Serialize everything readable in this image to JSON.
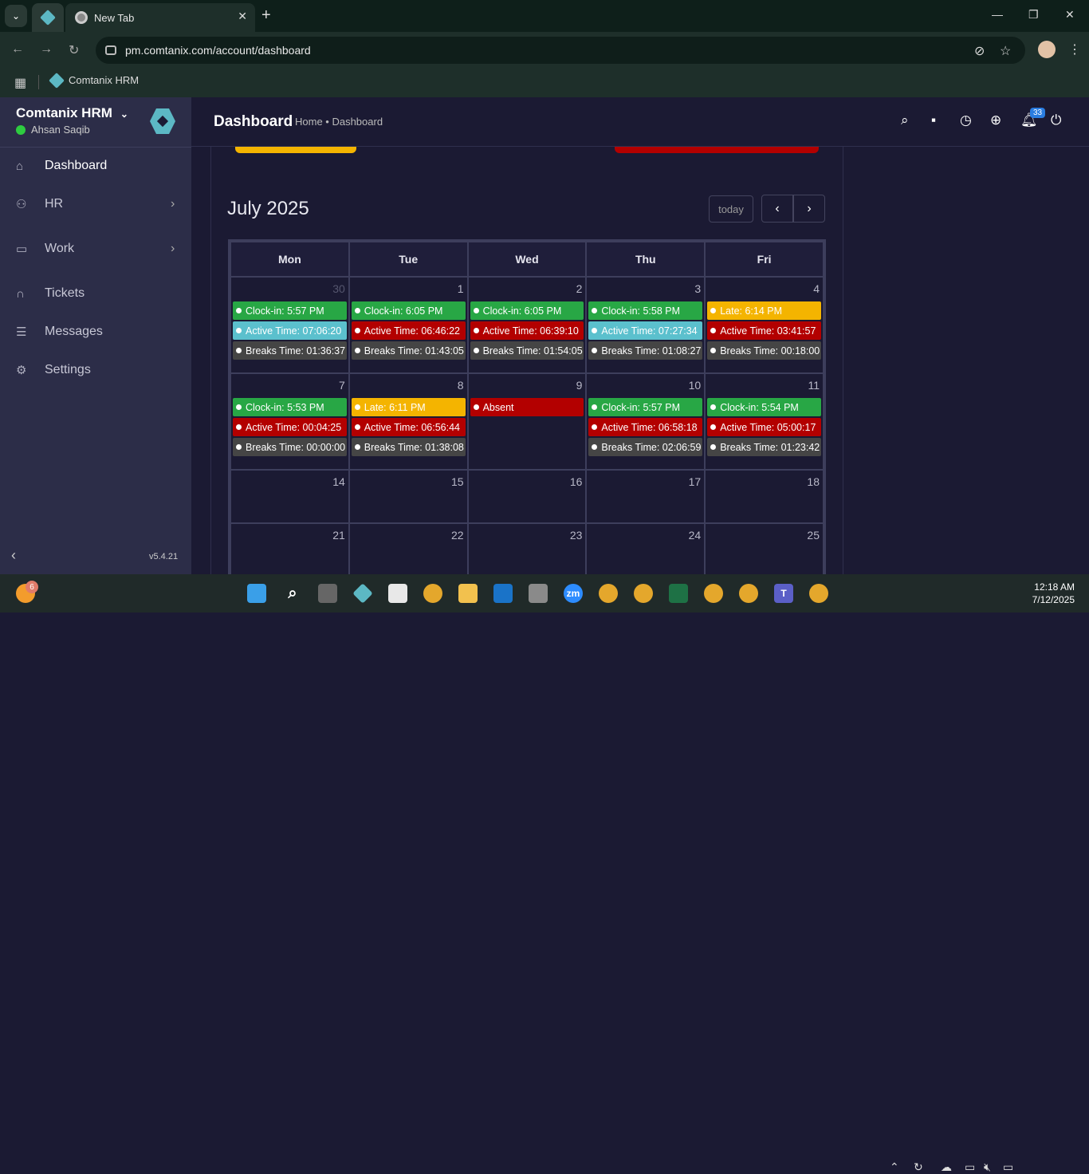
{
  "browser": {
    "tab_title": "New Tab",
    "url": "pm.comtanix.com/account/dashboard",
    "bookmark": "Comtanix HRM"
  },
  "sidebar": {
    "brand": "Comtanix HRM",
    "user": "Ahsan Saqib",
    "items": [
      {
        "label": "Dashboard",
        "icon": "home-icon"
      },
      {
        "label": "HR",
        "icon": "users-icon"
      },
      {
        "label": "Work",
        "icon": "briefcase-icon"
      },
      {
        "label": "Tickets",
        "icon": "headset-icon"
      },
      {
        "label": "Messages",
        "icon": "message-icon"
      },
      {
        "label": "Settings",
        "icon": "gear-icon"
      }
    ],
    "version": "v5.4.21"
  },
  "header": {
    "title": "Dashboard",
    "breadcrumb": "Home • Dashboard",
    "notifications": "33"
  },
  "calendar": {
    "title": "July 2025",
    "today_label": "today",
    "weekdays": [
      "Mon",
      "Tue",
      "Wed",
      "Thu",
      "Fri"
    ],
    "weeks": [
      [
        {
          "day": "30",
          "other": true,
          "events": [
            {
              "c": "g",
              "t": "Clock-in: 5:57 PM"
            },
            {
              "c": "t",
              "t": "Active Time: 07:06:20"
            },
            {
              "c": "k",
              "t": "Breaks Time: 01:36:37"
            }
          ]
        },
        {
          "day": "1",
          "events": [
            {
              "c": "g",
              "t": "Clock-in: 6:05 PM"
            },
            {
              "c": "r",
              "t": "Active Time: 06:46:22"
            },
            {
              "c": "k",
              "t": "Breaks Time: 01:43:05"
            }
          ]
        },
        {
          "day": "2",
          "events": [
            {
              "c": "g",
              "t": "Clock-in: 6:05 PM"
            },
            {
              "c": "r",
              "t": "Active Time: 06:39:10"
            },
            {
              "c": "k",
              "t": "Breaks Time: 01:54:05"
            }
          ]
        },
        {
          "day": "3",
          "events": [
            {
              "c": "g",
              "t": "Clock-in: 5:58 PM"
            },
            {
              "c": "t",
              "t": "Active Time: 07:27:34"
            },
            {
              "c": "k",
              "t": "Breaks Time: 01:08:27"
            }
          ]
        },
        {
          "day": "4",
          "events": [
            {
              "c": "y",
              "t": "Late: 6:14 PM"
            },
            {
              "c": "r",
              "t": "Active Time: 03:41:57"
            },
            {
              "c": "k",
              "t": "Breaks Time: 00:18:00"
            }
          ]
        }
      ],
      [
        {
          "day": "7",
          "events": [
            {
              "c": "g",
              "t": "Clock-in: 5:53 PM"
            },
            {
              "c": "r",
              "t": "Active Time: 00:04:25"
            },
            {
              "c": "k",
              "t": "Breaks Time: 00:00:00"
            }
          ]
        },
        {
          "day": "8",
          "events": [
            {
              "c": "y",
              "t": "Late: 6:11 PM"
            },
            {
              "c": "r",
              "t": "Active Time: 06:56:44"
            },
            {
              "c": "k",
              "t": "Breaks Time: 01:38:08"
            }
          ]
        },
        {
          "day": "9",
          "events": [
            {
              "c": "r",
              "t": "Absent"
            }
          ]
        },
        {
          "day": "10",
          "events": [
            {
              "c": "g",
              "t": "Clock-in: 5:57 PM"
            },
            {
              "c": "r",
              "t": "Active Time: 06:58:18"
            },
            {
              "c": "k",
              "t": "Breaks Time: 02:06:59"
            }
          ]
        },
        {
          "day": "11",
          "events": [
            {
              "c": "g",
              "t": "Clock-in: 5:54 PM"
            },
            {
              "c": "r",
              "t": "Active Time: 05:00:17"
            },
            {
              "c": "k",
              "t": "Breaks Time: 01:23:42"
            }
          ]
        }
      ],
      [
        {
          "day": "14",
          "events": []
        },
        {
          "day": "15",
          "events": []
        },
        {
          "day": "16",
          "events": []
        },
        {
          "day": "17",
          "events": []
        },
        {
          "day": "18",
          "events": []
        }
      ],
      [
        {
          "day": "21",
          "events": []
        },
        {
          "day": "22",
          "events": []
        },
        {
          "day": "23",
          "events": []
        },
        {
          "day": "24",
          "events": []
        },
        {
          "day": "25",
          "events": []
        }
      ]
    ]
  },
  "taskbar": {
    "badge": "6",
    "time": "12:18 AM",
    "date": "7/12/2025",
    "zoom_label": "zm",
    "teams_label": "T"
  }
}
